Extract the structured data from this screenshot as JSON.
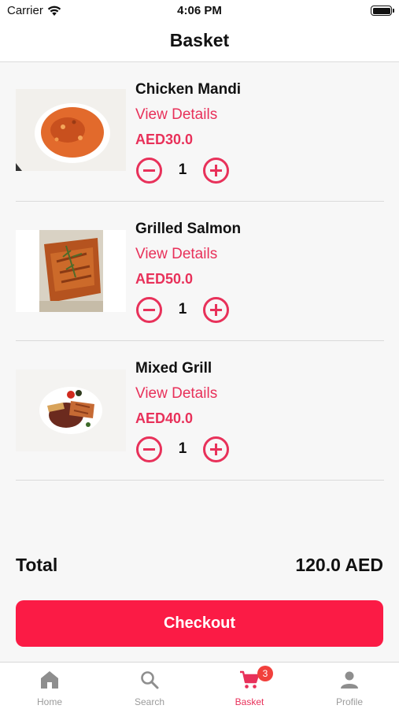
{
  "status_bar": {
    "carrier": "Carrier",
    "time": "4:06 PM"
  },
  "header": {
    "title": "Basket"
  },
  "basket": {
    "items": [
      {
        "name": "Chicken Mandi",
        "details_label": "View Details",
        "price": "AED30.0",
        "quantity": "1",
        "image_icon": "rice-dish-image"
      },
      {
        "name": "Grilled Salmon",
        "details_label": "View Details",
        "price": "AED50.0",
        "quantity": "1",
        "image_icon": "salmon-image"
      },
      {
        "name": "Mixed Grill",
        "details_label": "View Details",
        "price": "AED40.0",
        "quantity": "1",
        "image_icon": "grill-plate-image"
      }
    ]
  },
  "summary": {
    "total_label": "Total",
    "total_value": "120.0 AED"
  },
  "checkout": {
    "label": "Checkout"
  },
  "tab_bar": {
    "tabs": [
      {
        "label": "Home",
        "icon": "home-icon"
      },
      {
        "label": "Search",
        "icon": "search-icon"
      },
      {
        "label": "Basket",
        "icon": "cart-icon",
        "badge": "3",
        "active": true
      },
      {
        "label": "Profile",
        "icon": "person-icon"
      }
    ]
  },
  "colors": {
    "accent": "#e8315a",
    "checkout_bg": "#fb1b45",
    "background": "#f7f7f7",
    "badge": "#f1403c",
    "inactive_tab": "#9b9b9b"
  }
}
